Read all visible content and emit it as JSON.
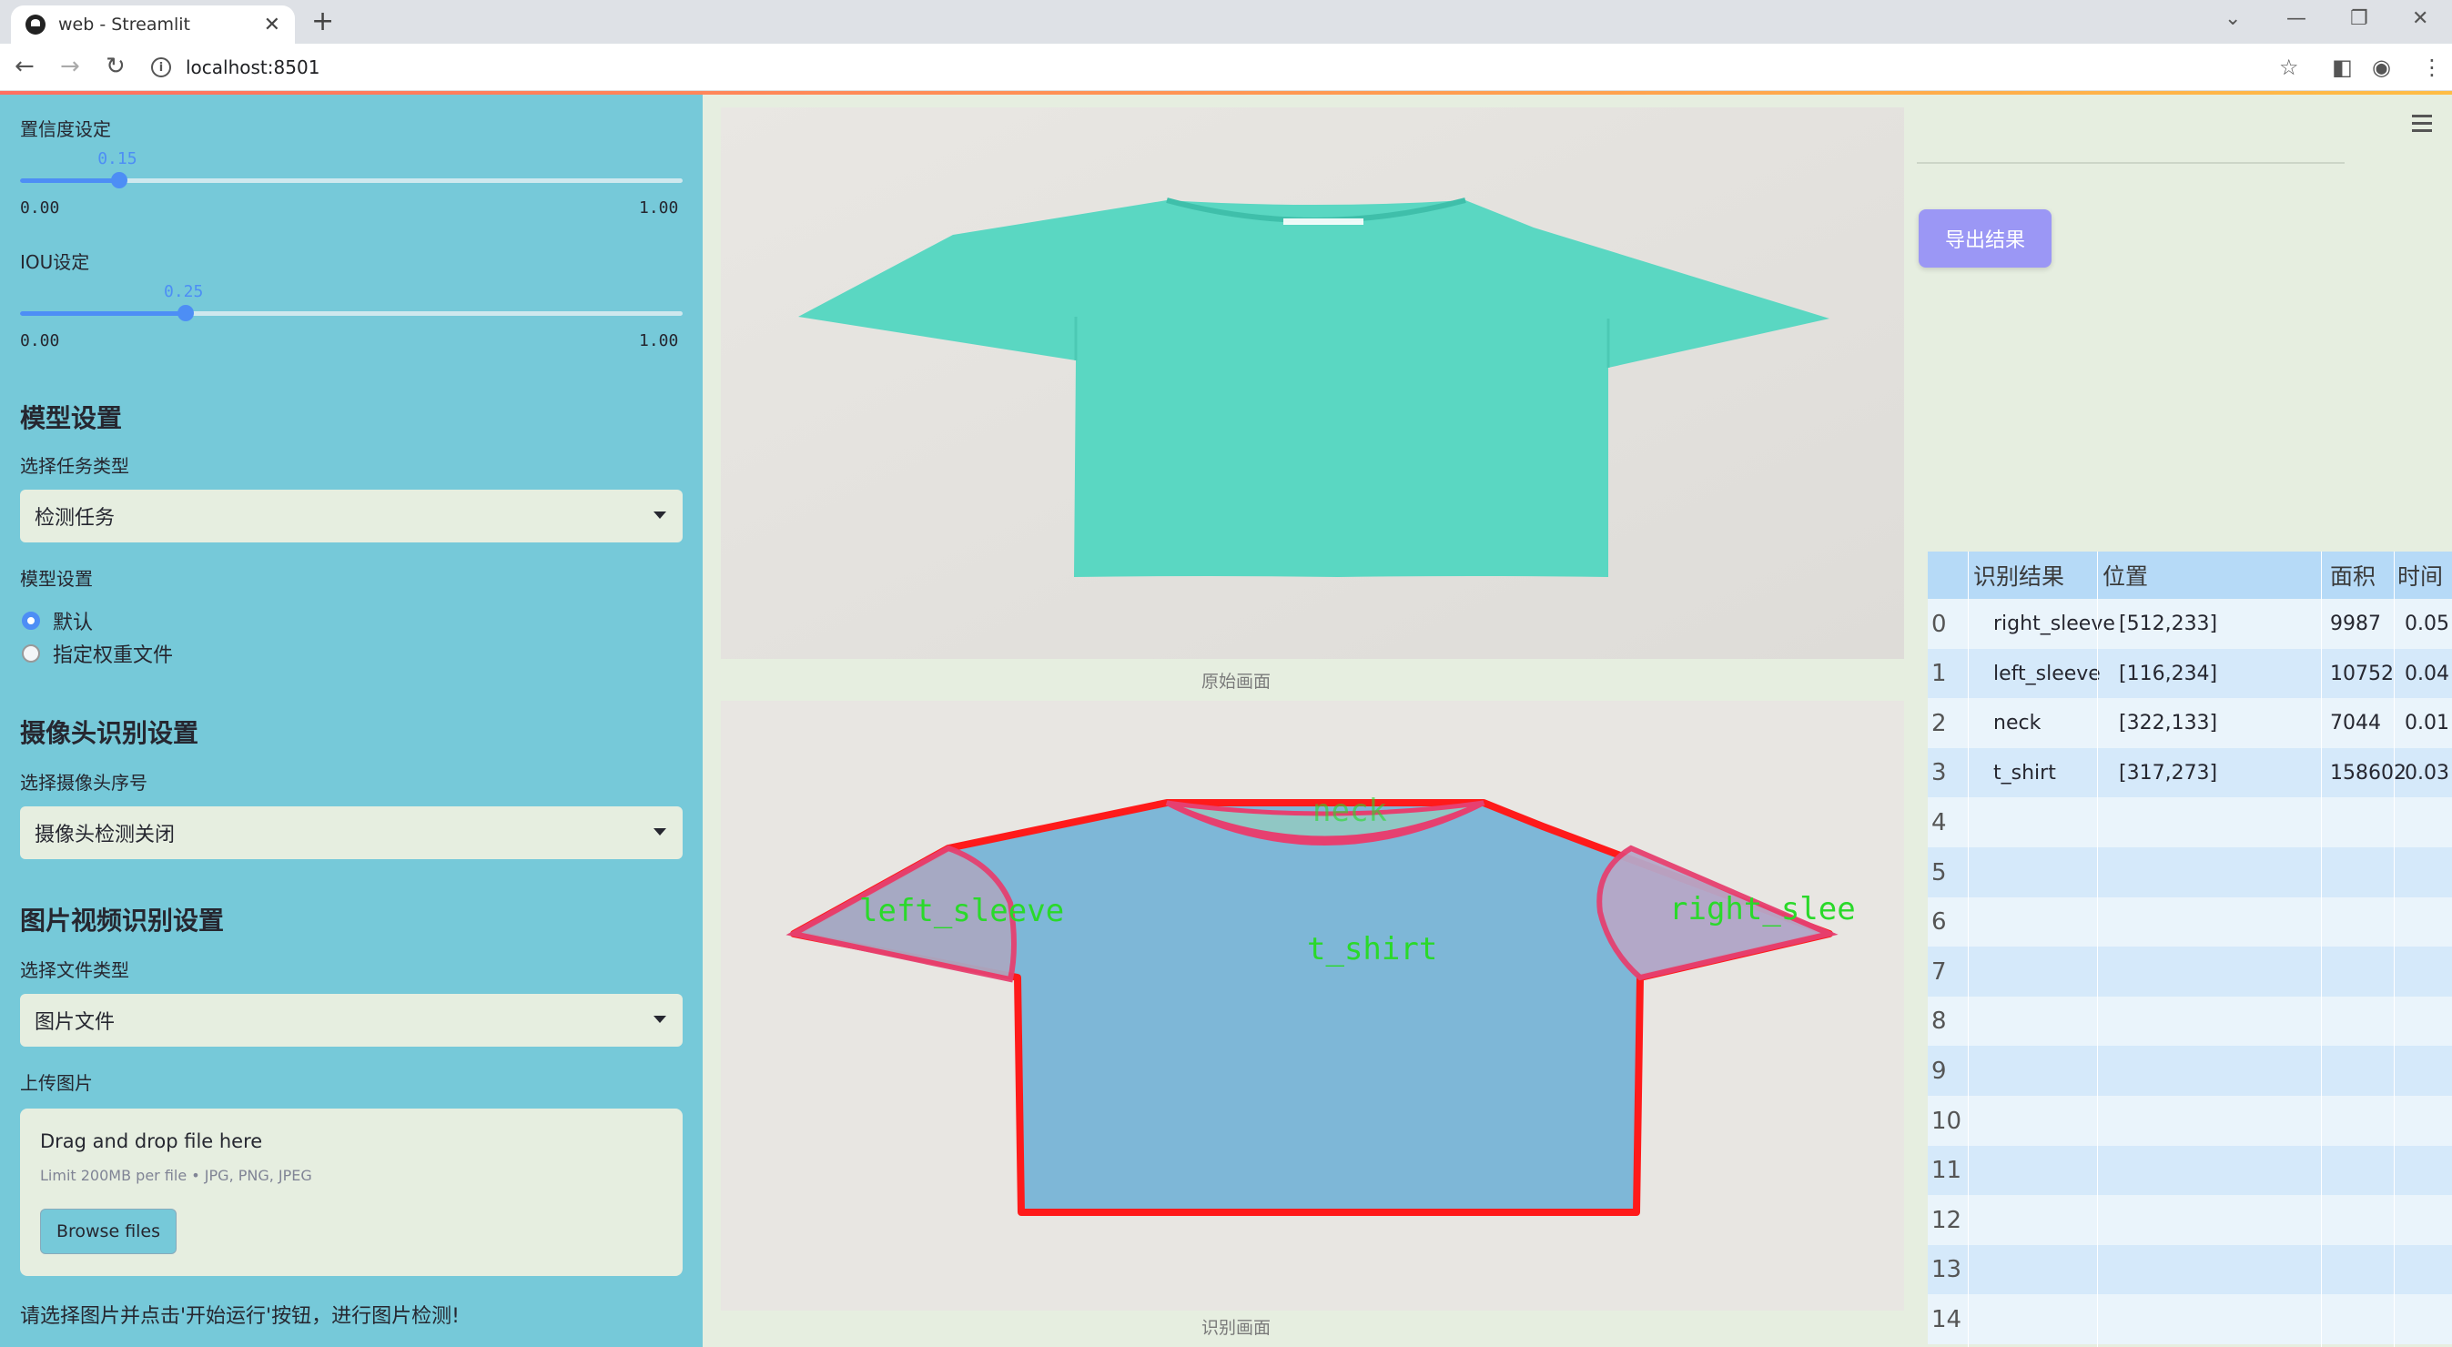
{
  "browser": {
    "tab_title": "web - Streamlit",
    "url": "localhost:8501"
  },
  "sidebar": {
    "confidence": {
      "label": "置信度设定",
      "value": "0.15",
      "fraction": 0.15,
      "min": "0.00",
      "max": "1.00"
    },
    "iou": {
      "label": "IOU设定",
      "value": "0.25",
      "fraction": 0.25,
      "min": "0.00",
      "max": "1.00"
    },
    "model_header": "模型设置",
    "task_label": "选择任务类型",
    "task_value": "检测任务",
    "model_label": "模型设置",
    "model_options": [
      "默认",
      "指定权重文件"
    ],
    "model_selected": 0,
    "camera_header": "摄像头识别设置",
    "camera_label": "选择摄像头序号",
    "camera_value": "摄像头检测关闭",
    "media_header": "图片视频识别设置",
    "filetype_label": "选择文件类型",
    "filetype_value": "图片文件",
    "upload_label": "上传图片",
    "upload_title": "Drag and drop file here",
    "upload_limit": "Limit 200MB per file • JPG, PNG, JPEG",
    "browse_label": "Browse files",
    "footer_text": "请选择图片并点击'开始运行'按钮，进行图片检测!"
  },
  "main": {
    "original_caption": "原始画面",
    "result_caption": "识别画面",
    "tshirt_color": "#5ad7c2",
    "overlay_labels": {
      "left_sleeve": "left_sleeve",
      "right_sleeve": "right_slee",
      "neck": "neck",
      "t_shirt": "t_shirt"
    },
    "export_label": "导出结果"
  },
  "table": {
    "columns": [
      "识别结果",
      "位置",
      "面积",
      "时间"
    ],
    "rows": [
      {
        "index": "0",
        "result": "right_sleeve",
        "position": "[512,233]",
        "area": "9987",
        "time": "0.05"
      },
      {
        "index": "1",
        "result": "left_sleeve",
        "position": "[116,234]",
        "area": "10752",
        "time": "0.04"
      },
      {
        "index": "2",
        "result": "neck",
        "position": "[322,133]",
        "area": "7044",
        "time": "0.01"
      },
      {
        "index": "3",
        "result": "t_shirt",
        "position": "[317,273]",
        "area": "158602",
        "time": "0.03"
      },
      {
        "index": "4",
        "result": "",
        "position": "",
        "area": "",
        "time": ""
      },
      {
        "index": "5",
        "result": "",
        "position": "",
        "area": "",
        "time": ""
      },
      {
        "index": "6",
        "result": "",
        "position": "",
        "area": "",
        "time": ""
      },
      {
        "index": "7",
        "result": "",
        "position": "",
        "area": "",
        "time": ""
      },
      {
        "index": "8",
        "result": "",
        "position": "",
        "area": "",
        "time": ""
      },
      {
        "index": "9",
        "result": "",
        "position": "",
        "area": "",
        "time": ""
      },
      {
        "index": "10",
        "result": "",
        "position": "",
        "area": "",
        "time": ""
      },
      {
        "index": "11",
        "result": "",
        "position": "",
        "area": "",
        "time": ""
      },
      {
        "index": "12",
        "result": "",
        "position": "",
        "area": "",
        "time": ""
      },
      {
        "index": "13",
        "result": "",
        "position": "",
        "area": "",
        "time": ""
      },
      {
        "index": "14",
        "result": "",
        "position": "",
        "area": "",
        "time": ""
      }
    ]
  }
}
